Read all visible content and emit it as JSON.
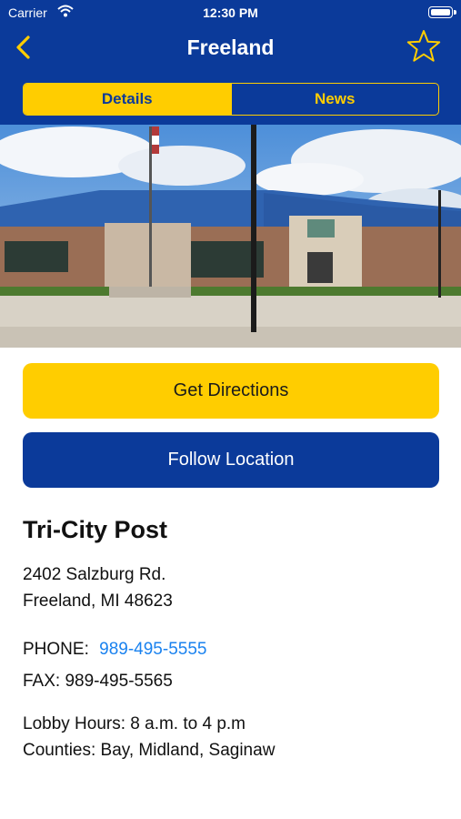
{
  "status_bar": {
    "carrier": "Carrier",
    "time": "12:30 PM"
  },
  "nav": {
    "title": "Freeland"
  },
  "tabs": [
    {
      "label": "Details",
      "selected": true
    },
    {
      "label": "News",
      "selected": false
    }
  ],
  "actions": {
    "directions_label": "Get Directions",
    "follow_label": "Follow Location"
  },
  "post": {
    "name": "Tri-City Post",
    "address_line1": "2402 Salzburg Rd.",
    "address_line2": "Freeland, MI 48623",
    "phone_label": "PHONE:",
    "phone": "989-495-5555",
    "fax": "FAX: 989-495-5565",
    "lobby_hours": "Lobby Hours: 8 a.m. to 4 p.m",
    "counties": "Counties: Bay, Midland, Saginaw"
  },
  "colors": {
    "brand_blue": "#0b3a9a",
    "brand_yellow": "#ffcd00",
    "link": "#1a82ef"
  }
}
